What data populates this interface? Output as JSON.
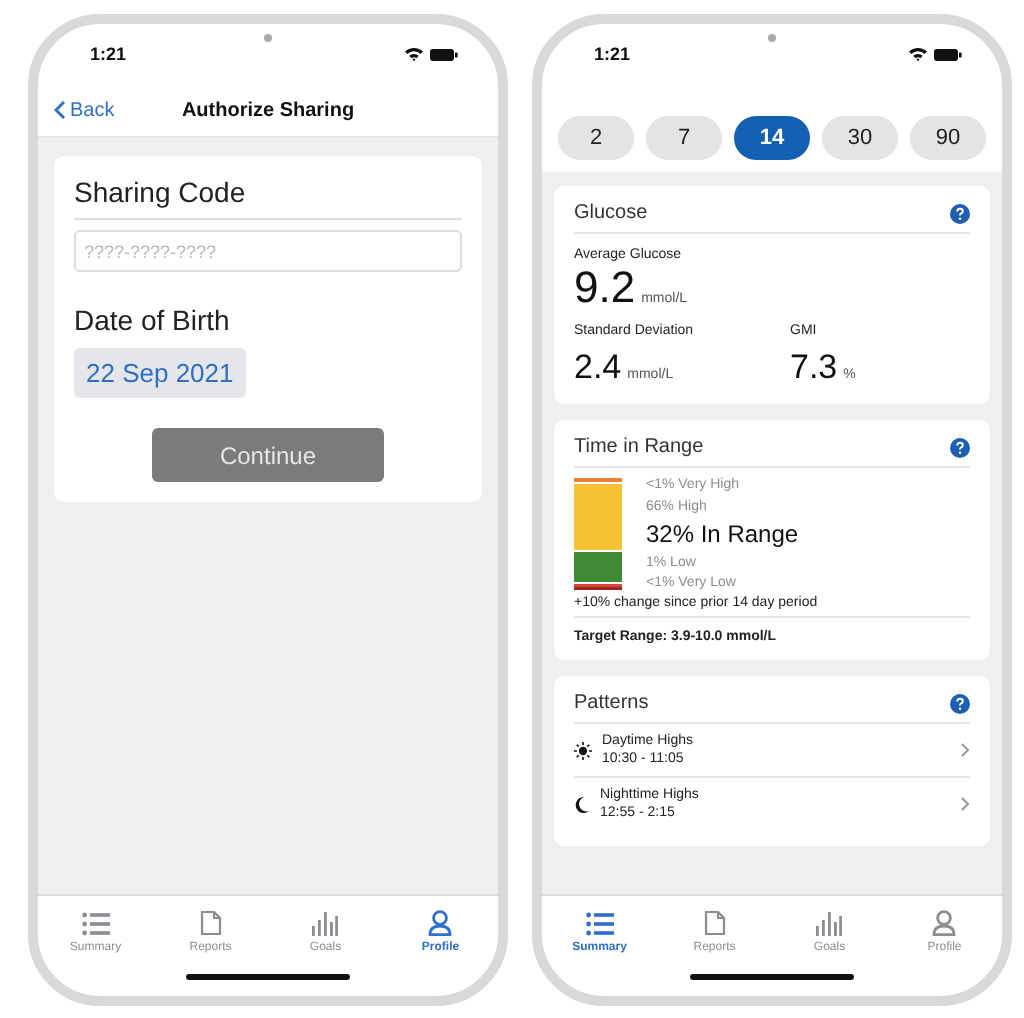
{
  "sharing_screen": {
    "status_time": "1:21",
    "nav": {
      "back": "Back",
      "title": "Authorize Sharing"
    },
    "form": {
      "code_label": "Sharing Code",
      "code_placeholder": "????-????-????",
      "dob_label": "Date of Birth",
      "dob_value": "22 Sep 2021",
      "button": "Continue"
    },
    "tab_bar": [
      {
        "label": "Summary",
        "selected": false
      },
      {
        "label": "Reports",
        "selected": false
      },
      {
        "label": "Goals",
        "selected": false
      },
      {
        "label": "Profile",
        "selected": true
      }
    ]
  },
  "summary_screen": {
    "status_time": "1:21",
    "periods": [
      {
        "label": "2",
        "selected": false
      },
      {
        "label": "7",
        "selected": false
      },
      {
        "label": "14",
        "selected": true
      },
      {
        "label": "30",
        "selected": false
      },
      {
        "label": "90",
        "selected": false
      }
    ],
    "glucose": {
      "title": "Glucose",
      "average_label": "Average Glucose",
      "average_value": "9.2",
      "average_unit": "mmol/L",
      "sd_label": "Standard Deviation",
      "sd_value": "2.4",
      "sd_unit": "mmol/L",
      "gmi_label": "GMI",
      "gmi_value": "7.3",
      "gmi_unit": "%"
    },
    "time_in_range": {
      "title": "Time in Range",
      "ranges": [
        {
          "label": "<1% Very High",
          "primary": false
        },
        {
          "label": "66% High",
          "primary": false
        },
        {
          "label": "32% In Range",
          "primary": true
        },
        {
          "label": "1% Low",
          "primary": false
        },
        {
          "label": "<1% Very Low",
          "primary": false
        }
      ],
      "change": "+10% change since prior 14 day period",
      "target": "Target Range: 3.9-10.0 mmol/L"
    },
    "patterns": {
      "title": "Patterns",
      "items": [
        {
          "kind": "day",
          "title": "Daytime Highs",
          "time": "10:30 - 11:05"
        },
        {
          "kind": "night",
          "title": "Nighttime Highs",
          "time": "12:55 - 2:15"
        }
      ]
    },
    "tab_bar": [
      {
        "label": "Summary",
        "selected": true
      },
      {
        "label": "Reports",
        "selected": false
      },
      {
        "label": "Goals",
        "selected": false
      },
      {
        "label": "Profile",
        "selected": false
      }
    ]
  }
}
